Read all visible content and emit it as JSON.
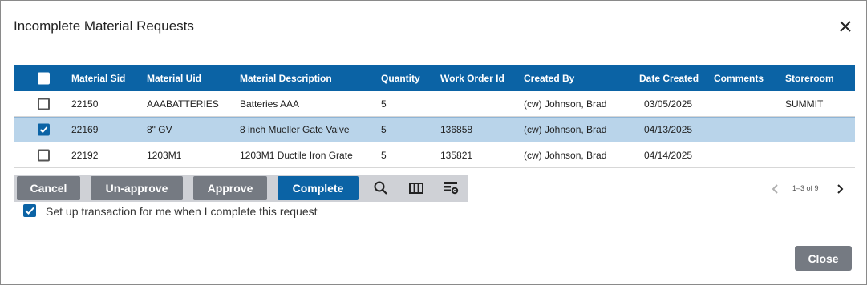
{
  "dialog": {
    "title": "Incomplete Material Requests"
  },
  "grid": {
    "columns": [
      "Material Sid",
      "Material Uid",
      "Material Description",
      "Quantity",
      "Work Order Id",
      "Created By",
      "Date Created",
      "Comments",
      "Storeroom"
    ],
    "rows": [
      {
        "checked": false,
        "sid": "22150",
        "uid": "AAABATTERIES",
        "desc": "Batteries AAA",
        "qty": "5",
        "wo": "",
        "created_by": "(cw) Johnson, Brad",
        "date": "03/05/2025",
        "comments": "",
        "storeroom": "SUMMIT"
      },
      {
        "checked": true,
        "sid": "22169",
        "uid": "8\" GV",
        "desc": "8 inch Mueller Gate Valve",
        "qty": "5",
        "wo": "136858",
        "created_by": "(cw) Johnson, Brad",
        "date": "04/13/2025",
        "comments": "",
        "storeroom": ""
      },
      {
        "checked": false,
        "sid": "22192",
        "uid": "1203M1",
        "desc": "1203M1 Ductile Iron Grate",
        "qty": "5",
        "wo": "135821",
        "created_by": "(cw) Johnson, Brad",
        "date": "04/14/2025",
        "comments": "",
        "storeroom": ""
      }
    ]
  },
  "toolbar": {
    "cancel": "Cancel",
    "unapprove": "Un-approve",
    "approve": "Approve",
    "complete": "Complete",
    "icons": [
      "search-icon",
      "columns-icon",
      "grid-settings-icon"
    ]
  },
  "pager": {
    "text": "1–3 of 9"
  },
  "setup": {
    "checked": true,
    "label": "Set up transaction for me when I complete this request"
  },
  "footer": {
    "close": "Close"
  },
  "colors": {
    "header": "#0b63a5",
    "selected_row": "#b9d4ea",
    "gray_button": "#757a82",
    "blue_button": "#0b63a5"
  }
}
